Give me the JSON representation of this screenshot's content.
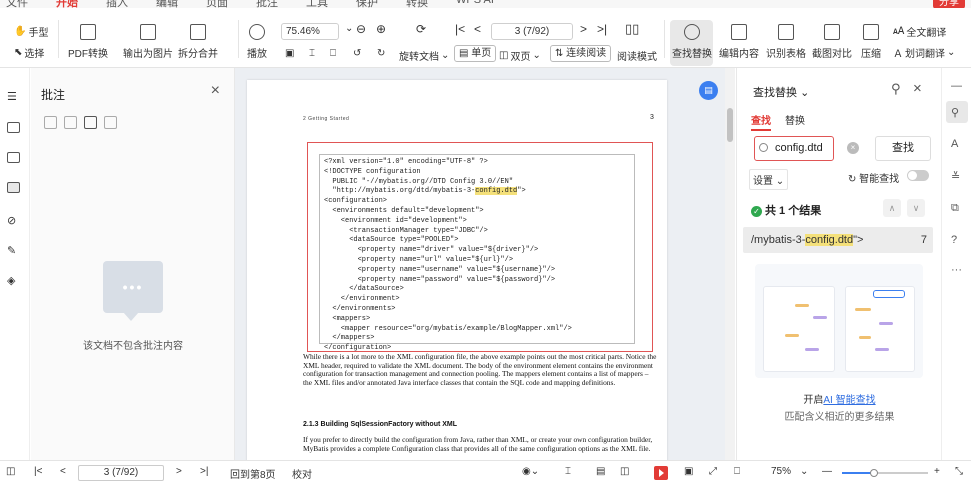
{
  "top_tabs": {
    "items": [
      "文件",
      "开始",
      "插入",
      "编辑",
      "页面",
      "批注",
      "工具",
      "保护",
      "转换",
      "WPS AI"
    ],
    "active": "开始",
    "share_label": "分享"
  },
  "toolbar": {
    "hand_label": "手型",
    "select_label": "选择",
    "pdf_convert_label": "PDF转换",
    "export_image_label": "输出为图片",
    "split_merge_label": "拆分合并",
    "play_label": "播放",
    "zoom_value": "75.46%",
    "page_value": "3 (7/92)",
    "rotate_doc_label": "旋转文档",
    "single_page_label": "单页",
    "double_page_label": "双页",
    "continuous_label": "连续阅读",
    "read_mode_label": "阅读模式",
    "find_replace_label": "查找替换",
    "edit_content_label": "编辑内容",
    "recognize_table_label": "识别表格",
    "screenshot_compare_label": "截图对比",
    "compress_label": "压缩",
    "full_translate_label": "全文翻译",
    "word_translate_label": "划词翻译"
  },
  "left_panel": {
    "title": "批注",
    "empty_text": "该文档不包含批注内容"
  },
  "document": {
    "header": "2 Getting Started",
    "page_number": "3",
    "code_lines": [
      "<?xml version=\"1.0\" encoding=\"UTF-8\" ?>",
      "<!DOCTYPE configuration",
      "  PUBLIC \"-//mybatis.org//DTD Config 3.0//EN\"",
      "  \"http://mybatis.org/dtd/mybatis-3-",
      "config.dtd",
      "\">",
      "<configuration>",
      "  <environments default=\"development\">",
      "    <environment id=\"development\">",
      "      <transactionManager type=\"JDBC\"/>",
      "      <dataSource type=\"POOLED\">",
      "        <property name=\"driver\" value=\"${driver}\"/>",
      "        <property name=\"url\" value=\"${url}\"/>",
      "        <property name=\"username\" value=\"${username}\"/>",
      "        <property name=\"password\" value=\"${password}\"/>",
      "      </dataSource>",
      "    </environment>",
      "  </environments>",
      "  <mappers>",
      "    <mapper resource=\"org/mybatis/example/BlogMapper.xml\"/>",
      "  </mappers>",
      "</configuration>"
    ],
    "paragraph1": "While there is a lot more to the XML configuration file, the above example points out the most critical parts. Notice the XML header, required to validate the XML document. The body of the environment element contains the environment configuration for transaction management and connection pooling. The mappers element contains a list of mappers – the XML files and/or annotated Java interface classes that contain the SQL code and mapping definitions.",
    "subheading": "2.1.3 Building SqlSessionFactory without XML",
    "paragraph2": "If you prefer to directly build the configuration from Java, rather than XML, or create your own configuration builder, MyBatis provides a complete Configuration class that provides all of the same configuration options as the XML file."
  },
  "right_panel": {
    "title": "查找替换",
    "tab_find": "查找",
    "tab_replace": "替换",
    "search_value": "config.dtd",
    "find_button": "查找",
    "settings_label": "设置",
    "ai_find_label": "智能查找",
    "result_count": "共 1 个结果",
    "result_prefix": "/mybatis-3-",
    "result_match": "config.dtd",
    "result_suffix": "\">",
    "result_page": "7",
    "ai_link_prefix": "开启",
    "ai_link": "AI 智能查找",
    "ai_sub": "匹配含义相近的更多结果"
  },
  "statusbar": {
    "page_value": "3 (7/92)",
    "back_label": "回到第8页",
    "proofread_label": "校对",
    "zoom_value": "75%",
    "zoom_fraction": 0.37
  },
  "colors": {
    "accent_red": "#e23b36",
    "highlight": "#f4e07a",
    "link_blue": "#2f6de0",
    "success_green": "#2fa84f"
  }
}
